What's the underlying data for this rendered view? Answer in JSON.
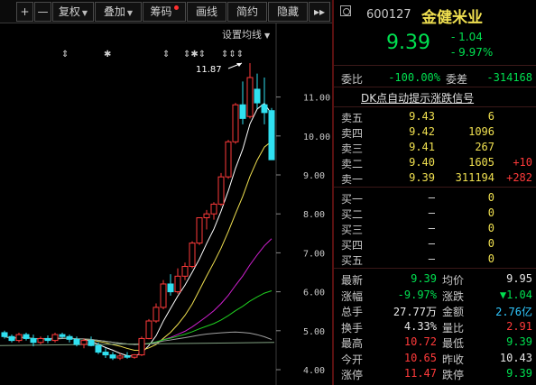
{
  "toolbar": {
    "plus": "+",
    "minus": "—",
    "rights": "复权",
    "overlay": "叠加",
    "chips": "筹码",
    "draw": "画线",
    "brief": "简约",
    "hide": "隐藏",
    "more": "▸▸"
  },
  "chart": {
    "settings_label": "设置均线",
    "peak_label": "11.87",
    "y_axis": [
      "11.00",
      "10.00",
      "9.00",
      "8.00",
      "7.00",
      "6.00",
      "5.00",
      "4.00"
    ],
    "event_markers": [
      "⇕",
      "✱",
      "⇕",
      "⇕✱⇕",
      "⇕⇕⇕"
    ],
    "colors": {
      "up": "#ff3a3a",
      "down": "#30e0f0",
      "ma5": "#ffffff",
      "ma10": "#f0e050",
      "ma20": "#d020d0",
      "ma30": "#20d020",
      "ma60": "#a0a0a0"
    }
  },
  "chart_data": {
    "type": "candlestick",
    "ylim": [
      4.0,
      12.0
    ],
    "ohlc": [
      {
        "o": 4.95,
        "h": 5.0,
        "l": 4.8,
        "c": 4.85
      },
      {
        "o": 4.85,
        "h": 4.9,
        "l": 4.7,
        "c": 4.75
      },
      {
        "o": 4.75,
        "h": 4.95,
        "l": 4.7,
        "c": 4.9
      },
      {
        "o": 4.9,
        "h": 4.95,
        "l": 4.75,
        "c": 4.8
      },
      {
        "o": 4.8,
        "h": 4.9,
        "l": 4.6,
        "c": 4.7
      },
      {
        "o": 4.7,
        "h": 4.85,
        "l": 4.65,
        "c": 4.8
      },
      {
        "o": 4.8,
        "h": 4.88,
        "l": 4.68,
        "c": 4.75
      },
      {
        "o": 4.75,
        "h": 4.95,
        "l": 4.7,
        "c": 4.9
      },
      {
        "o": 4.9,
        "h": 4.95,
        "l": 4.8,
        "c": 4.85
      },
      {
        "o": 4.85,
        "h": 4.9,
        "l": 4.7,
        "c": 4.78
      },
      {
        "o": 4.78,
        "h": 4.85,
        "l": 4.6,
        "c": 4.65
      },
      {
        "o": 4.65,
        "h": 4.8,
        "l": 4.55,
        "c": 4.75
      },
      {
        "o": 4.75,
        "h": 4.85,
        "l": 4.6,
        "c": 4.62
      },
      {
        "o": 4.62,
        "h": 4.7,
        "l": 4.4,
        "c": 4.45
      },
      {
        "o": 4.45,
        "h": 4.55,
        "l": 4.3,
        "c": 4.38
      },
      {
        "o": 4.38,
        "h": 4.45,
        "l": 4.25,
        "c": 4.3
      },
      {
        "o": 4.3,
        "h": 4.42,
        "l": 4.25,
        "c": 4.35
      },
      {
        "o": 4.35,
        "h": 4.45,
        "l": 4.28,
        "c": 4.32
      },
      {
        "o": 4.32,
        "h": 4.4,
        "l": 4.28,
        "c": 4.38
      },
      {
        "o": 4.38,
        "h": 4.85,
        "l": 4.35,
        "c": 4.8
      },
      {
        "o": 4.8,
        "h": 5.3,
        "l": 4.78,
        "c": 5.25
      },
      {
        "o": 5.25,
        "h": 5.7,
        "l": 5.2,
        "c": 5.6
      },
      {
        "o": 5.6,
        "h": 6.3,
        "l": 5.55,
        "c": 6.2
      },
      {
        "o": 6.2,
        "h": 6.45,
        "l": 5.9,
        "c": 6.0
      },
      {
        "o": 6.0,
        "h": 6.6,
        "l": 5.95,
        "c": 6.4
      },
      {
        "o": 6.4,
        "h": 6.75,
        "l": 6.3,
        "c": 6.65
      },
      {
        "o": 6.65,
        "h": 7.3,
        "l": 6.6,
        "c": 7.25
      },
      {
        "o": 7.25,
        "h": 7.9,
        "l": 7.2,
        "c": 7.9
      },
      {
        "o": 7.9,
        "h": 8.1,
        "l": 7.6,
        "c": 8.0
      },
      {
        "o": 8.0,
        "h": 8.3,
        "l": 7.85,
        "c": 8.25
      },
      {
        "o": 8.25,
        "h": 9.05,
        "l": 8.2,
        "c": 8.95
      },
      {
        "o": 8.95,
        "h": 9.9,
        "l": 8.9,
        "c": 9.85
      },
      {
        "o": 9.85,
        "h": 10.85,
        "l": 9.8,
        "c": 10.8
      },
      {
        "o": 10.8,
        "h": 11.4,
        "l": 10.3,
        "c": 10.45
      },
      {
        "o": 10.5,
        "h": 11.87,
        "l": 10.45,
        "c": 11.5
      },
      {
        "o": 11.2,
        "h": 11.6,
        "l": 10.7,
        "c": 10.85
      },
      {
        "o": 10.8,
        "h": 11.5,
        "l": 10.3,
        "c": 10.6
      },
      {
        "o": 10.65,
        "h": 10.72,
        "l": 9.39,
        "c": 9.39
      }
    ]
  },
  "quote": {
    "code": "600127",
    "name": "金健米业",
    "price": "9.39",
    "change": "- 1.04",
    "change_pct": "- 9.97%",
    "wb_label": "委比",
    "wb_value": "-100.00%",
    "wc_label": "委差",
    "wc_value": "-314168",
    "dk_link": "DK点自动提示涨跌信号",
    "asks": [
      {
        "label": "卖五",
        "price": "9.43",
        "vol": "6",
        "delta": ""
      },
      {
        "label": "卖四",
        "price": "9.42",
        "vol": "1096",
        "delta": ""
      },
      {
        "label": "卖三",
        "price": "9.41",
        "vol": "267",
        "delta": ""
      },
      {
        "label": "卖二",
        "price": "9.40",
        "vol": "1605",
        "delta": "+10"
      },
      {
        "label": "卖一",
        "price": "9.39",
        "vol": "311194",
        "delta": "+282"
      }
    ],
    "bids": [
      {
        "label": "买一",
        "price": "—",
        "vol": "0"
      },
      {
        "label": "买二",
        "price": "—",
        "vol": "0"
      },
      {
        "label": "买三",
        "price": "—",
        "vol": "0"
      },
      {
        "label": "买四",
        "price": "—",
        "vol": "0"
      },
      {
        "label": "买五",
        "price": "—",
        "vol": "0"
      }
    ],
    "stats": [
      {
        "l1": "最新",
        "v1": "9.39",
        "c1": "green",
        "l2": "均价",
        "v2": "9.95",
        "c2": "white"
      },
      {
        "l1": "涨幅",
        "v1": "-9.97%",
        "c1": "green",
        "l2": "涨跌",
        "v2": "▼1.04",
        "c2": "green"
      },
      {
        "l1": "总手",
        "v1": "27.77万",
        "c1": "white",
        "l2": "金额",
        "v2": "2.76亿",
        "c2": "cyan"
      },
      {
        "l1": "换手",
        "v1": "4.33%",
        "c1": "white",
        "l2": "量比",
        "v2": "2.91",
        "c2": "red"
      },
      {
        "l1": "最高",
        "v1": "10.72",
        "c1": "red",
        "l2": "最低",
        "v2": "9.39",
        "c2": "green"
      },
      {
        "l1": "今开",
        "v1": "10.65",
        "c1": "red",
        "l2": "昨收",
        "v2": "10.43",
        "c2": "white"
      },
      {
        "l1": "涨停",
        "v1": "11.47",
        "c1": "red",
        "l2": "跌停",
        "v2": "9.39",
        "c2": "green"
      }
    ]
  }
}
